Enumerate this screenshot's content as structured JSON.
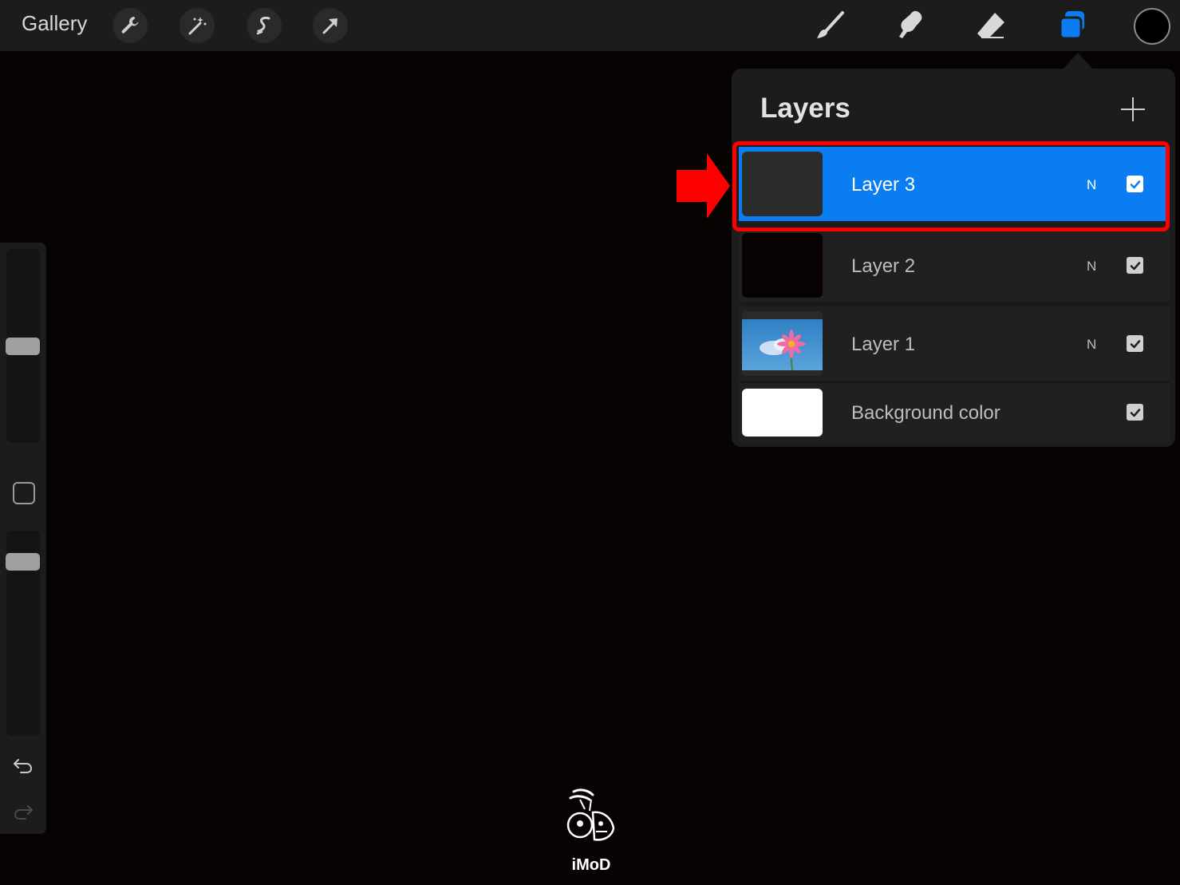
{
  "toolbar": {
    "gallery_label": "Gallery",
    "left_tools": [
      "wrench-icon",
      "magic-wand-icon",
      "selection-s-icon",
      "transform-arrow-icon"
    ],
    "right_tools": [
      "brush-icon",
      "smudge-icon",
      "eraser-icon",
      "layers-icon"
    ],
    "active_tool": "layers-icon",
    "active_color": "#000000",
    "accent_color": "#0a7df2"
  },
  "layers_panel": {
    "title": "Layers",
    "add_icon": "plus-icon",
    "layers": [
      {
        "name": "Layer 3",
        "blend": "N",
        "visible": true,
        "selected": true
      },
      {
        "name": "Layer 2",
        "blend": "N",
        "visible": true,
        "selected": false
      },
      {
        "name": "Layer 1",
        "blend": "N",
        "visible": true,
        "selected": false
      },
      {
        "name": "Background color",
        "blend": "",
        "visible": true,
        "selected": false
      }
    ]
  },
  "annotation": {
    "highlight_color": "#ff0000",
    "arrow_icon": "red-arrow-right-icon"
  },
  "sidebar": {
    "brush_size_level": 0.5,
    "opacity_level": 0.88,
    "undo_icon": "undo-icon",
    "redo_icon": "redo-icon"
  },
  "watermark": {
    "text": "iMoD"
  }
}
